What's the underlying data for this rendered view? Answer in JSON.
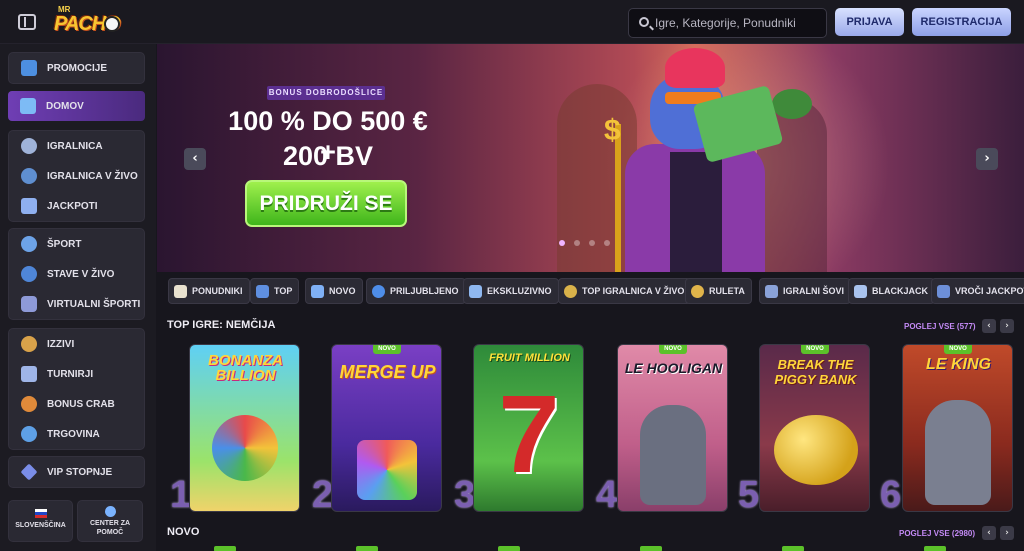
{
  "header": {
    "logo_small": "MR",
    "logo_big": "PACHO",
    "search_placeholder": "Igre, Kategorije, Ponudniki",
    "login": "PRIJAVA",
    "register": "REGISTRACIJA"
  },
  "sidebar": {
    "promo": "PROMOCIJE",
    "home": "DOMOV",
    "casino": [
      "IGRALNICA",
      "IGRALNICA V ŽIVO",
      "JACKPOTI"
    ],
    "sport": [
      "ŠPORT",
      "STAVE V ŽIVO",
      "VIRTUALNI ŠPORTI"
    ],
    "extras": [
      "IZZIVI",
      "TURNIRJI",
      "BONUS CRAB",
      "TRGOVINA"
    ],
    "vip": "VIP STOPNJE",
    "language": "SLOVENŠČINA",
    "help": "CENTER ZA POMOČ"
  },
  "banner": {
    "tag": "BONUS DOBRODOŠLICE",
    "line1": "100 % DO 500 € +",
    "line2": "200 BV",
    "cta": "PRIDRUŽI SE",
    "dot_count": 4,
    "active_dot": 0
  },
  "categories": [
    "PONUDNIKI",
    "TOP",
    "NOVO",
    "PRILJUBLJENO",
    "EKSKLUZIVNO",
    "TOP IGRALNICA V ŽIVO",
    "RULETA",
    "IGRALNI ŠOVI",
    "BLACKJACK",
    "VROČI JACKPOTI"
  ],
  "top_games": {
    "title": "TOP IGRE: NEMČIJA",
    "see_all": "POGLEJ VSE (577)",
    "games": [
      {
        "rank": "1",
        "title": "BONANZA BILLION",
        "new": false
      },
      {
        "rank": "2",
        "title": "MERGE UP",
        "new": true
      },
      {
        "rank": "3",
        "title": "FRUIT MILLION",
        "new": false
      },
      {
        "rank": "4",
        "title": "LE HOOLIGAN",
        "new": true
      },
      {
        "rank": "5",
        "title": "BREAK THE PIGGY BANK",
        "new": true
      },
      {
        "rank": "6",
        "title": "LE KING",
        "new": true
      }
    ],
    "new_badge": "NOVO"
  },
  "new_section": {
    "title": "NOVO",
    "see_all": "POGLEJ VSE (2980)"
  },
  "colors": {
    "accent": "#6f3eb4",
    "cta_green": "#3fb51b",
    "link_purple": "#c38af5"
  }
}
